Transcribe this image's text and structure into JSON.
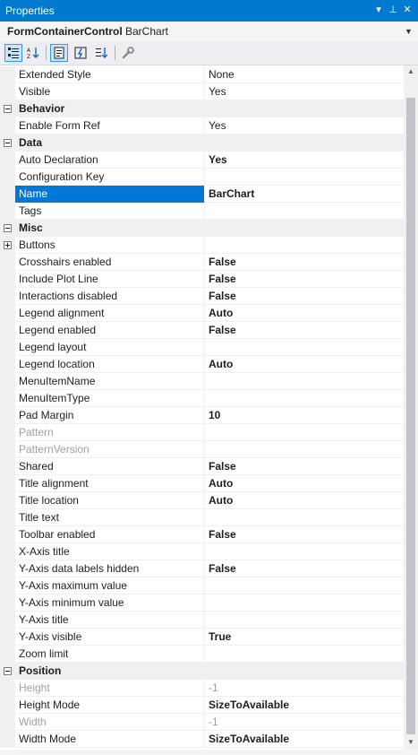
{
  "window": {
    "title": "Properties",
    "dropdown_glyph": "▾",
    "pin_glyph": "⊥",
    "close_glyph": "✕"
  },
  "object_selector": {
    "name": "FormContainerControl",
    "type": "BarChart",
    "dropdown_glyph": "▼"
  },
  "toolbar": {
    "icons": [
      "categorized-icon",
      "alphabetical-icon",
      "properties-icon",
      "events-icon",
      "property-pages-icon",
      "wrench-icon"
    ]
  },
  "scrollbar": {
    "up": "▲",
    "down": "▼"
  },
  "rows": [
    {
      "kind": "prop",
      "name": "Extended Style",
      "value": "None",
      "bold": false
    },
    {
      "kind": "prop",
      "name": "Visible",
      "value": "Yes",
      "bold": false
    },
    {
      "kind": "cat",
      "name": "Behavior",
      "expanded": true
    },
    {
      "kind": "prop",
      "name": "Enable Form Ref",
      "value": "Yes",
      "bold": false
    },
    {
      "kind": "cat",
      "name": "Data",
      "expanded": true
    },
    {
      "kind": "prop",
      "name": "Auto Declaration",
      "value": "Yes",
      "bold": true
    },
    {
      "kind": "prop",
      "name": "Configuration Key",
      "value": "",
      "bold": false
    },
    {
      "kind": "prop",
      "name": "Name",
      "value": "BarChart",
      "bold": true,
      "selected": true
    },
    {
      "kind": "prop",
      "name": "Tags",
      "value": "",
      "bold": false
    },
    {
      "kind": "cat",
      "name": "Misc",
      "expanded": true
    },
    {
      "kind": "prop",
      "name": "Buttons",
      "value": "",
      "bold": false,
      "expander": true
    },
    {
      "kind": "prop",
      "name": "Crosshairs enabled",
      "value": "False",
      "bold": true
    },
    {
      "kind": "prop",
      "name": "Include Plot Line",
      "value": "False",
      "bold": true
    },
    {
      "kind": "prop",
      "name": "Interactions disabled",
      "value": "False",
      "bold": true
    },
    {
      "kind": "prop",
      "name": "Legend alignment",
      "value": "Auto",
      "bold": true
    },
    {
      "kind": "prop",
      "name": "Legend enabled",
      "value": "False",
      "bold": true
    },
    {
      "kind": "prop",
      "name": "Legend layout",
      "value": "",
      "bold": false
    },
    {
      "kind": "prop",
      "name": "Legend location",
      "value": "Auto",
      "bold": true
    },
    {
      "kind": "prop",
      "name": "MenuItemName",
      "value": "",
      "bold": false
    },
    {
      "kind": "prop",
      "name": "MenuItemType",
      "value": "",
      "bold": false
    },
    {
      "kind": "prop",
      "name": "Pad Margin",
      "value": "10",
      "bold": true
    },
    {
      "kind": "prop",
      "name": "Pattern",
      "value": "",
      "bold": false,
      "disabled": true
    },
    {
      "kind": "prop",
      "name": "PatternVersion",
      "value": "",
      "bold": false,
      "disabled": true
    },
    {
      "kind": "prop",
      "name": "Shared",
      "value": "False",
      "bold": true
    },
    {
      "kind": "prop",
      "name": "Title alignment",
      "value": "Auto",
      "bold": true
    },
    {
      "kind": "prop",
      "name": "Title location",
      "value": "Auto",
      "bold": true
    },
    {
      "kind": "prop",
      "name": "Title text",
      "value": "",
      "bold": false
    },
    {
      "kind": "prop",
      "name": "Toolbar enabled",
      "value": "False",
      "bold": true
    },
    {
      "kind": "prop",
      "name": "X-Axis title",
      "value": "",
      "bold": false
    },
    {
      "kind": "prop",
      "name": "Y-Axis data labels hidden",
      "value": "False",
      "bold": true
    },
    {
      "kind": "prop",
      "name": "Y-Axis maximum  value",
      "value": "",
      "bold": false
    },
    {
      "kind": "prop",
      "name": "Y-Axis minimum value",
      "value": "",
      "bold": false
    },
    {
      "kind": "prop",
      "name": "Y-Axis title",
      "value": "",
      "bold": false
    },
    {
      "kind": "prop",
      "name": "Y-Axis visible",
      "value": "True",
      "bold": true
    },
    {
      "kind": "prop",
      "name": "Zoom limit",
      "value": "",
      "bold": false
    },
    {
      "kind": "cat",
      "name": "Position",
      "expanded": true
    },
    {
      "kind": "prop",
      "name": "Height",
      "value": "-1",
      "bold": false,
      "disabled": true
    },
    {
      "kind": "prop",
      "name": "Height Mode",
      "value": "SizeToAvailable",
      "bold": true
    },
    {
      "kind": "prop",
      "name": "Width",
      "value": "-1",
      "bold": false,
      "disabled": true
    },
    {
      "kind": "prop",
      "name": "Width Mode",
      "value": "SizeToAvailable",
      "bold": true
    }
  ]
}
